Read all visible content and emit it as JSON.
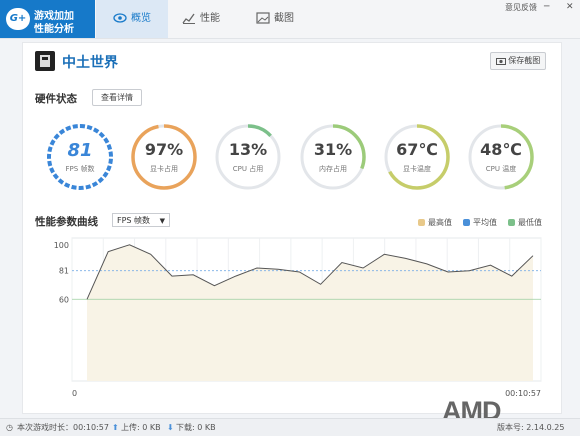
{
  "app": {
    "logo_badge": "G+",
    "logo_line1": "游戏加加",
    "logo_line2": "性能分析",
    "tabs": [
      {
        "label": "概览",
        "active": true
      },
      {
        "label": "性能",
        "active": false
      },
      {
        "label": "截图",
        "active": false
      }
    ],
    "feedback_label": "意见反馈",
    "brand_color": "#1679c9"
  },
  "game": {
    "name": "中土世界",
    "screenshot_button": "保存截图"
  },
  "hardware": {
    "title": "硬件状态",
    "detail_button": "查看详情",
    "gauges": [
      {
        "value": "81",
        "label": "FPS 帧数",
        "fraction": 0.81,
        "color": "#3a86d8"
      },
      {
        "value": "97%",
        "label": "显卡占用",
        "fraction": 0.97,
        "color": "#e9a35b"
      },
      {
        "value": "13%",
        "label": "CPU 占用",
        "fraction": 0.13,
        "color": "#7cc08a"
      },
      {
        "value": "31%",
        "label": "内存占用",
        "fraction": 0.31,
        "color": "#9ccb7a"
      },
      {
        "value": "67℃",
        "label": "显卡温度",
        "fraction": 0.67,
        "color": "#c6cd6a"
      },
      {
        "value": "48℃",
        "label": "CPU 温度",
        "fraction": 0.48,
        "color": "#a8cf7a"
      }
    ]
  },
  "curve": {
    "title": "性能参数曲线",
    "select_value": "FPS 帧数",
    "legend": [
      {
        "label": "最高值",
        "color": "#e8c98a"
      },
      {
        "label": "平均值",
        "color": "#4a90d9"
      },
      {
        "label": "最低值",
        "color": "#7cc08a"
      }
    ]
  },
  "chart_data": {
    "type": "area",
    "x": [
      0,
      1,
      2,
      3,
      4,
      5,
      6,
      7,
      8,
      9,
      10,
      11,
      12,
      13,
      14,
      15,
      16,
      17,
      18,
      19,
      20,
      21,
      22,
      23
    ],
    "values": [
      60,
      95,
      100,
      93,
      77,
      78,
      70,
      77,
      83,
      82,
      80,
      71,
      87,
      83,
      93,
      90,
      86,
      80,
      81,
      85,
      77,
      92
    ],
    "avg": 81,
    "min": 60,
    "ylim": [
      0,
      105
    ],
    "y_ticks": [
      "100",
      "81",
      "60",
      "0"
    ],
    "x_start_label": "0",
    "x_end_label": "00:10:57"
  },
  "status": {
    "session_time": "本次游戏时长：00:10:57",
    "upload": "上传: 0 KB",
    "download": "下载: 0 KB",
    "version": "版本号: 2.14.0.25"
  },
  "brand_watermark": "AMD"
}
